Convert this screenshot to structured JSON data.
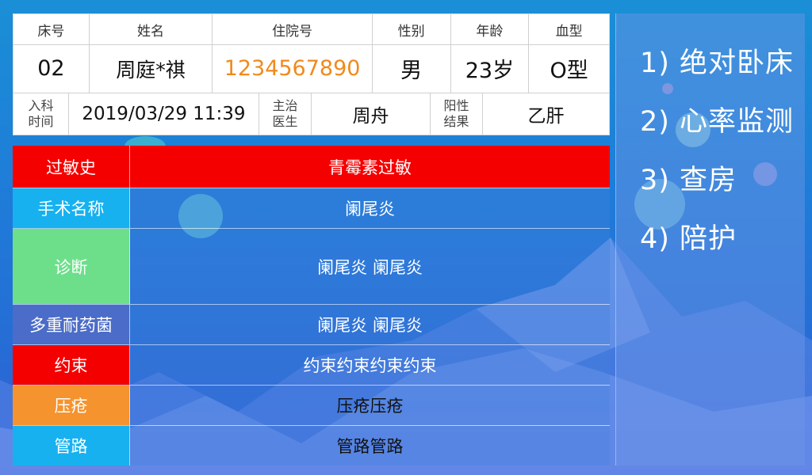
{
  "header_labels": {
    "bed_no": "床号",
    "name": "姓名",
    "admission_no": "住院号",
    "gender": "性别",
    "age": "年龄",
    "blood_type": "血型"
  },
  "patient": {
    "bed_no": "02",
    "name": "周庭*祺",
    "admission_no": "1234567890",
    "gender": "男",
    "age": "23岁",
    "blood_type": "O型"
  },
  "extra": {
    "admit_label_line1": "入科",
    "admit_label_line2": "时间",
    "admit_time": "2019/03/29 11:39",
    "doctor_label_line1": "主治",
    "doctor_label_line2": "医生",
    "doctor": "周舟",
    "positive_label_line1": "阳性",
    "positive_label_line2": "结果",
    "positive_result": "乙肝"
  },
  "medical": {
    "rows": [
      {
        "label": "过敏史",
        "value": "青霉素过敏"
      },
      {
        "label": "手术名称",
        "value": "阑尾炎"
      },
      {
        "label": "诊断",
        "value": "阑尾炎 阑尾炎"
      },
      {
        "label": "多重耐药菌",
        "value": "阑尾炎 阑尾炎"
      },
      {
        "label": "约束",
        "value": "约束约束约束约束"
      },
      {
        "label": "压疮",
        "value": "压疮压疮"
      },
      {
        "label": "管路",
        "value": "管路管路"
      }
    ],
    "label_colors": [
      "#f50000",
      "#17b1ef",
      "#6ddf8b",
      "#4b6cc8",
      "#f50000",
      "#f5932e",
      "#17b1ef"
    ]
  },
  "care_items": [
    "1) 绝对卧床",
    "2) 心率监测",
    "3) 查房",
    "4) 陪护"
  ],
  "colors": {
    "accent_orange": "#f08a1c",
    "allergy_red": "#f50000"
  }
}
